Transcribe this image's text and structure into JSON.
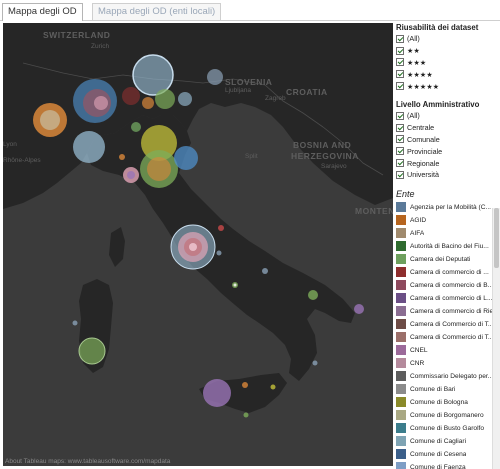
{
  "tabs": [
    {
      "label": "Mappa degli OD"
    },
    {
      "label": "Mappa degli OD (enti locali)"
    }
  ],
  "map": {
    "labels": {
      "switzerland": "SWITZERLAND",
      "croatia": "CROATIA",
      "slovenia": "SLOVENIA",
      "bosnia": "BOSNIA AND",
      "herzegovina": "HERZEGOVINA",
      "montenegro": "MONTENE",
      "zurich": "Zurich",
      "lyon": "Lyon",
      "rhone_alpes": "Rhône-Alpes",
      "ljubljana": "Ljubljana",
      "zagreb": "Zagreb",
      "sarajevo": "Sarajevo",
      "split": "Split"
    },
    "attribution": "About Tableau maps: www.tableausoftware.com/mapdata",
    "bubble_colors": {
      "blue": "#4f8fc9",
      "orange": "#d9873a",
      "lightblue": "#9cc3dc",
      "yellow": "#c4c13a",
      "pink": "#e3a5b8",
      "green": "#7dad5a",
      "purple": "#9a74b6",
      "red": "#c94a4a",
      "grey": "#8aa0b5"
    }
  },
  "filters": {
    "riusabilita": {
      "title": "Riusabilità dei dataset",
      "options": [
        "(All)",
        "★★",
        "★★★",
        "★★★★",
        "★★★★★"
      ]
    },
    "livello": {
      "title": "Livello Amministrativo",
      "options": [
        "(All)",
        "Centrale",
        "Comunale",
        "Provinciale",
        "Regionale",
        "Università"
      ]
    }
  },
  "legend": {
    "title": "Ente",
    "items": [
      {
        "label": "Agenzia per la Mobilità (C...",
        "color": "#5b7a99"
      },
      {
        "label": "AGID",
        "color": "#b6651f"
      },
      {
        "label": "AIFA",
        "color": "#a08a6d"
      },
      {
        "label": "Autorità di Bacino del Fiu...",
        "color": "#2f6b2f"
      },
      {
        "label": "Camera dei Deputati",
        "color": "#6ea05e"
      },
      {
        "label": "Camera di commercio di ...",
        "color": "#8e2e2e"
      },
      {
        "label": "Camera di commercio di B...",
        "color": "#8e4a5e"
      },
      {
        "label": "Camera di commercio di L...",
        "color": "#6b4f86"
      },
      {
        "label": "Camera di commercio di Rieti",
        "color": "#8b6e92"
      },
      {
        "label": "Camera di Commercio di T...",
        "color": "#6d4c46"
      },
      {
        "label": "Camera di Commercio di T...",
        "color": "#9b6f6a"
      },
      {
        "label": "CNEL",
        "color": "#9c6a9a"
      },
      {
        "label": "CNR",
        "color": "#b48a9c"
      },
      {
        "label": "Commissario Delegato per...",
        "color": "#5d5d5d"
      },
      {
        "label": "Comune di Bari",
        "color": "#8b8b8b"
      },
      {
        "label": "Comune di Bologna",
        "color": "#8a8a2a"
      },
      {
        "label": "Comune di Borgomanero",
        "color": "#a9a883"
      },
      {
        "label": "Comune di Busto Garolfo",
        "color": "#3c7d8c"
      },
      {
        "label": "Comune di Cagliari",
        "color": "#7fa4b4"
      },
      {
        "label": "Comune di Cesena",
        "color": "#3b5f8a"
      },
      {
        "label": "Comune di Faenza",
        "color": "#7e9ec5"
      }
    ]
  }
}
